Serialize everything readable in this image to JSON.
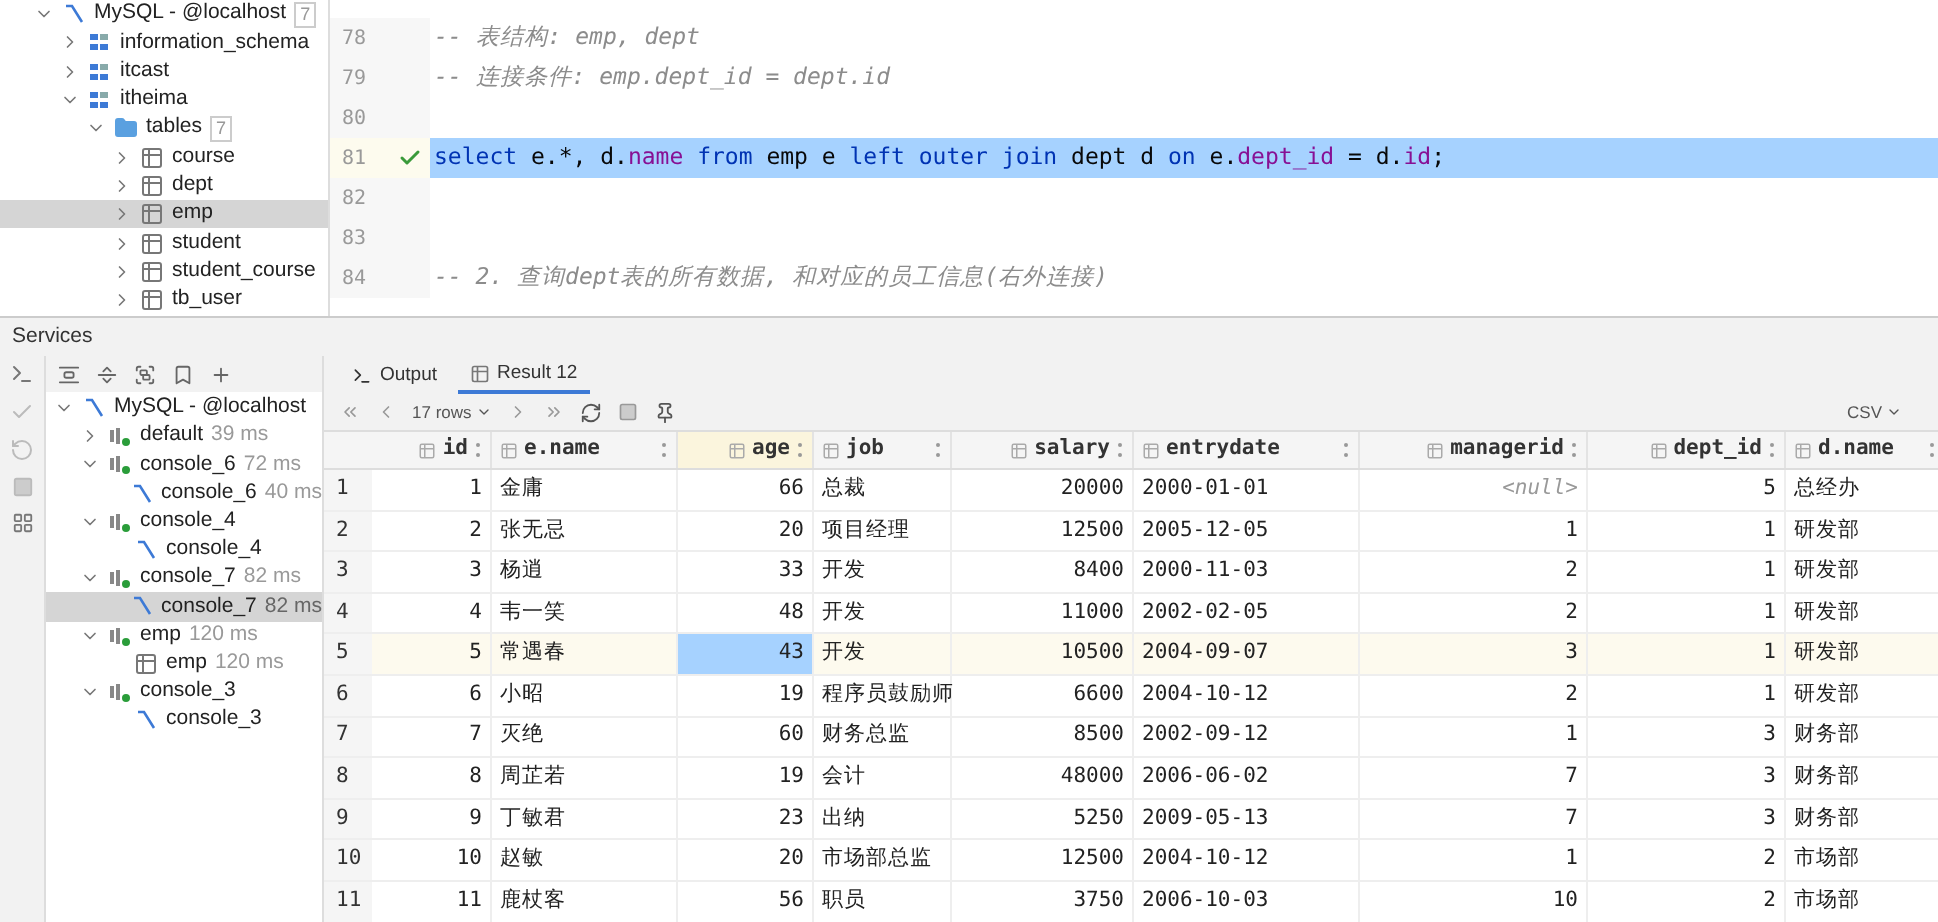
{
  "db_tree": [
    {
      "kind": "connection",
      "label": "MySQL - @localhost",
      "count": "7",
      "expanded": true,
      "selected": false,
      "children": [
        {
          "kind": "schema",
          "label": "information_schema",
          "expanded": false,
          "selected": false
        },
        {
          "kind": "schema",
          "label": "itcast",
          "expanded": false,
          "selected": false
        },
        {
          "kind": "schema",
          "label": "itheima",
          "expanded": true,
          "selected": false,
          "children": [
            {
              "kind": "folder",
              "label": "tables",
              "count": "7",
              "expanded": true,
              "selected": false,
              "children": [
                {
                  "kind": "table",
                  "label": "course",
                  "expanded": false,
                  "selected": false
                },
                {
                  "kind": "table",
                  "label": "dept",
                  "expanded": false,
                  "selected": false
                },
                {
                  "kind": "table",
                  "label": "emp",
                  "expanded": false,
                  "selected": true
                },
                {
                  "kind": "table",
                  "label": "student",
                  "expanded": false,
                  "selected": false
                },
                {
                  "kind": "table",
                  "label": "student_course",
                  "expanded": false,
                  "selected": false
                },
                {
                  "kind": "table",
                  "label": "tb_user",
                  "expanded": false,
                  "selected": false
                }
              ]
            }
          ]
        }
      ]
    }
  ],
  "editor": {
    "lines": [
      {
        "number": "78",
        "selected": false,
        "checked": false,
        "tokens": [
          {
            "kind": "comment",
            "text": "-- 表结构: emp, dept"
          }
        ]
      },
      {
        "number": "79",
        "selected": false,
        "checked": false,
        "tokens": [
          {
            "kind": "comment",
            "text": "-- 连接条件: emp.dept_id = dept.id"
          }
        ]
      },
      {
        "number": "80",
        "selected": false,
        "checked": false
      },
      {
        "number": "81",
        "selected": true,
        "checked": true,
        "tokens": [
          {
            "kind": "keyword",
            "text": "select"
          },
          {
            "kind": "plain",
            "text": " e.*, d."
          },
          {
            "kind": "field",
            "text": "name"
          },
          {
            "kind": "keyword",
            "text": " from"
          },
          {
            "kind": "plain",
            "text": " emp e "
          },
          {
            "kind": "keyword",
            "text": "left outer join"
          },
          {
            "kind": "plain",
            "text": " dept d "
          },
          {
            "kind": "keyword",
            "text": "on"
          },
          {
            "kind": "plain",
            "text": " e."
          },
          {
            "kind": "field",
            "text": "dept_id"
          },
          {
            "kind": "plain",
            "text": " = d."
          },
          {
            "kind": "field",
            "text": "id"
          },
          {
            "kind": "plain",
            "text": ";"
          }
        ]
      },
      {
        "number": "82",
        "selected": false,
        "checked": false
      },
      {
        "number": "83",
        "selected": false,
        "checked": false
      },
      {
        "number": "84",
        "selected": false,
        "checked": false,
        "tokens": [
          {
            "kind": "comment",
            "text": "-- 2. 查询dept表的所有数据, 和对应的员工信息(右外连接)"
          }
        ]
      }
    ]
  },
  "services": {
    "title": "Services",
    "tree": [
      {
        "kind": "connection",
        "label": "MySQL - @localhost",
        "expanded": true,
        "selected": false,
        "children": [
          {
            "kind": "session",
            "label": "default",
            "time": "39 ms",
            "expanded": false,
            "selected": false
          },
          {
            "kind": "session",
            "label": "console_6",
            "time": "72 ms",
            "expanded": true,
            "selected": false,
            "children": [
              {
                "kind": "console",
                "label": "console_6",
                "time": "40 ms",
                "selected": false
              }
            ]
          },
          {
            "kind": "session",
            "label": "console_4",
            "expanded": true,
            "selected": false,
            "children": [
              {
                "kind": "console",
                "label": "console_4",
                "selected": false
              }
            ]
          },
          {
            "kind": "session",
            "label": "console_7",
            "time": "82 ms",
            "expanded": true,
            "selected": false,
            "children": [
              {
                "kind": "console",
                "label": "console_7",
                "time": "82 ms",
                "selected": true
              }
            ]
          },
          {
            "kind": "session",
            "label": "emp",
            "time": "120 ms",
            "expanded": true,
            "selected": false,
            "children": [
              {
                "kind": "table",
                "label": "emp",
                "time": "120 ms",
                "selected": false
              }
            ]
          },
          {
            "kind": "session",
            "label": "console_3",
            "expanded": true,
            "selected": false,
            "children": [
              {
                "kind": "console",
                "label": "console_3",
                "selected": false
              }
            ]
          }
        ]
      }
    ]
  },
  "results": {
    "tabs": [
      {
        "kind": "output",
        "label": "Output",
        "selected": false
      },
      {
        "kind": "result",
        "label": "Result 12",
        "selected": true
      }
    ],
    "row_count": "17 rows",
    "export_format": "CSV",
    "columns": [
      {
        "label": "id",
        "numeric": true,
        "selected": false
      },
      {
        "label": "e.name",
        "numeric": false,
        "selected": false
      },
      {
        "label": "age",
        "numeric": true,
        "selected": true
      },
      {
        "label": "job",
        "numeric": false,
        "selected": false
      },
      {
        "label": "salary",
        "numeric": true,
        "selected": false
      },
      {
        "label": "entrydate",
        "numeric": false,
        "selected": false
      },
      {
        "label": "managerid",
        "numeric": true,
        "selected": false
      },
      {
        "label": "dept_id",
        "numeric": true,
        "selected": false
      },
      {
        "label": "d.name",
        "numeric": false,
        "selected": false
      }
    ],
    "rows": [
      {
        "number": "1",
        "selected": false,
        "cells": [
          "1",
          "金庸",
          "66",
          "总裁",
          "20000",
          "2000-01-01",
          {
            "kind": "null",
            "text": "<null>"
          },
          "5",
          "总经办"
        ]
      },
      {
        "number": "2",
        "selected": false,
        "cells": [
          "2",
          "张无忌",
          "20",
          "项目经理",
          "12500",
          "2005-12-05",
          "1",
          "1",
          "研发部"
        ]
      },
      {
        "number": "3",
        "selected": false,
        "cells": [
          "3",
          "杨逍",
          "33",
          "开发",
          "8400",
          "2000-11-03",
          "2",
          "1",
          "研发部"
        ]
      },
      {
        "number": "4",
        "selected": false,
        "cells": [
          "4",
          "韦一笑",
          "48",
          "开发",
          "11000",
          "2002-02-05",
          "2",
          "1",
          "研发部"
        ]
      },
      {
        "number": "5",
        "selected": true,
        "cells": [
          "5",
          "常遇春",
          "43",
          "开发",
          "10500",
          "2004-09-07",
          "3",
          "1",
          "研发部"
        ]
      },
      {
        "number": "6",
        "selected": false,
        "cells": [
          "6",
          "小昭",
          "19",
          "程序员鼓励师",
          "6600",
          "2004-10-12",
          "2",
          "1",
          "研发部"
        ]
      },
      {
        "number": "7",
        "selected": false,
        "cells": [
          "7",
          "灭绝",
          "60",
          "财务总监",
          "8500",
          "2002-09-12",
          "1",
          "3",
          "财务部"
        ]
      },
      {
        "number": "8",
        "selected": false,
        "cells": [
          "8",
          "周芷若",
          "19",
          "会计",
          "48000",
          "2006-06-02",
          "7",
          "3",
          "财务部"
        ]
      },
      {
        "number": "9",
        "selected": false,
        "cells": [
          "9",
          "丁敏君",
          "23",
          "出纳",
          "5250",
          "2009-05-13",
          "7",
          "3",
          "财务部"
        ]
      },
      {
        "number": "10",
        "selected": false,
        "cells": [
          "10",
          "赵敏",
          "20",
          "市场部总监",
          "12500",
          "2004-10-12",
          "1",
          "2",
          "市场部"
        ]
      },
      {
        "number": "11",
        "selected": false,
        "cells": [
          "11",
          "鹿杖客",
          "56",
          "职员",
          "3750",
          "2006-10-03",
          "10",
          "2",
          "市场部"
        ]
      }
    ]
  }
}
